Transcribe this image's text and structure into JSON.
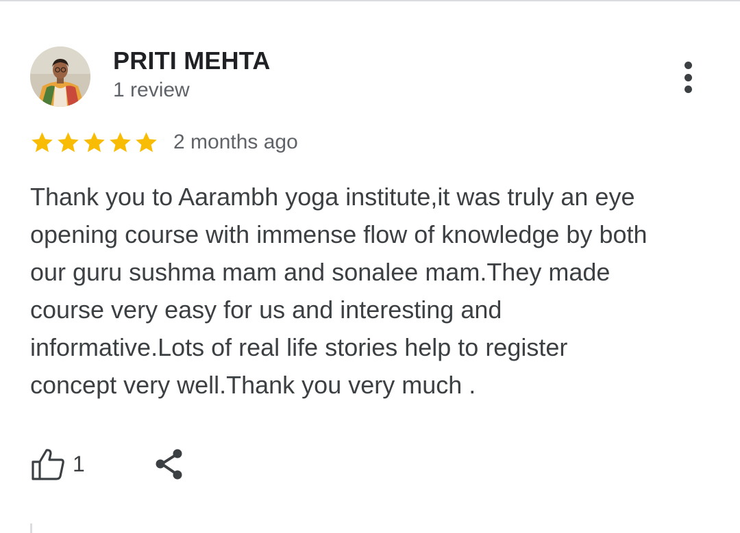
{
  "review": {
    "author": {
      "name": "PRITI MEHTA",
      "meta": "1 review",
      "avatar_icon": "profile-photo"
    },
    "rating": {
      "value": 5,
      "max": 5,
      "star_color": "#f9bc05"
    },
    "date": "2 months ago",
    "text": "Thank you to Aarambh yoga institute,it was truly an eye\nopening course with immense flow of knowledge by both\nour guru sushma mam and sonalee mam.They made\ncourse very easy for us and interesting and\ninformative.Lots of real life stories help to register\nconcept very well.Thank you very much .",
    "actions": {
      "like_icon": "thumbs-up-icon",
      "like_count": "1",
      "share_icon": "share-icon",
      "more_icon": "more-vert-icon"
    }
  },
  "colors": {
    "text_primary": "#202124",
    "text_body": "#3c4043",
    "text_secondary": "#5f6368",
    "divider": "#dadce0"
  }
}
